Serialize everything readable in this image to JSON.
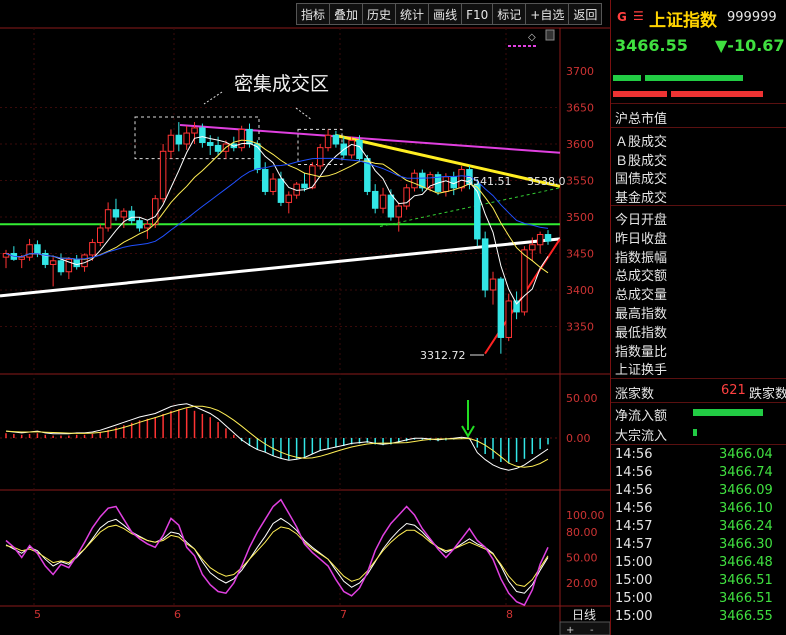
{
  "toolbar": [
    "指标",
    "叠加",
    "历史",
    "统计",
    "画线",
    "F10",
    "标记",
    "+自选",
    "返回"
  ],
  "annotations": {
    "cluster_label": "密集成交区",
    "level_high": "3541.51",
    "level_high2": "3538.0",
    "low_label": "3312.72",
    "kline_label": "日线"
  },
  "x_axis_ticks": [
    "5",
    "6",
    "7",
    "8"
  ],
  "price_axis": [
    "3700",
    "3650",
    "3600",
    "3550",
    "3500",
    "3450",
    "3400",
    "3350",
    "3300"
  ],
  "macd_axis": [
    "50.00",
    "0.00"
  ],
  "kdj_axis": [
    "100.00",
    "80.00",
    "50.00",
    "20.00"
  ],
  "quote": {
    "flag": "G",
    "menu_glyph": "☰",
    "name": "上证指数",
    "code": "999999",
    "price": "3466.55",
    "change": "▼-10.67"
  },
  "info_labels": [
    "沪总市值",
    "Ａ股成交",
    "Ｂ股成交",
    "国债成交",
    "基金成交",
    "今日开盘",
    "昨日收盘",
    "指数振幅",
    "总成交额",
    "总成交量",
    "最高指数",
    "最低指数",
    "指数量比",
    "上证换手"
  ],
  "breadth": {
    "up_label": "涨家数",
    "up_count": "621",
    "down_label": "跌家数"
  },
  "flows": {
    "net_inflow": "净流入额",
    "block_inflow": "大宗流入"
  },
  "ticks": [
    {
      "time": "14:56",
      "price": "3466.04"
    },
    {
      "time": "14:56",
      "price": "3466.74"
    },
    {
      "time": "14:56",
      "price": "3466.09"
    },
    {
      "time": "14:56",
      "price": "3466.10"
    },
    {
      "time": "14:57",
      "price": "3466.24"
    },
    {
      "time": "14:57",
      "price": "3466.30"
    },
    {
      "time": "15:00",
      "price": "3466.48"
    },
    {
      "time": "15:00",
      "price": "3466.51"
    },
    {
      "time": "15:00",
      "price": "3466.51"
    },
    {
      "time": "15:00",
      "price": "3466.55"
    }
  ],
  "colors": {
    "up": "#ff3333",
    "down": "#33e6e6",
    "accent_yellow": "#ffd400",
    "green_text": "#40e040"
  },
  "chart_data": [
    {
      "type": "candlestick",
      "ylim": [
        3300,
        3700
      ],
      "ohlc": [
        [
          3445,
          3455,
          3430,
          3450
        ],
        [
          3450,
          3460,
          3440,
          3442
        ],
        [
          3442,
          3448,
          3430,
          3445
        ],
        [
          3445,
          3470,
          3440,
          3462
        ],
        [
          3462,
          3468,
          3445,
          3450
        ],
        [
          3450,
          3455,
          3430,
          3435
        ],
        [
          3435,
          3445,
          3405,
          3440
        ],
        [
          3440,
          3450,
          3420,
          3425
        ],
        [
          3425,
          3445,
          3415,
          3442
        ],
        [
          3442,
          3448,
          3428,
          3432
        ],
        [
          3432,
          3450,
          3425,
          3448
        ],
        [
          3448,
          3470,
          3440,
          3465
        ],
        [
          3465,
          3490,
          3460,
          3485
        ],
        [
          3485,
          3520,
          3480,
          3510
        ],
        [
          3510,
          3525,
          3495,
          3500
        ],
        [
          3500,
          3512,
          3485,
          3508
        ],
        [
          3508,
          3515,
          3490,
          3495
        ],
        [
          3495,
          3500,
          3480,
          3485
        ],
        [
          3485,
          3495,
          3470,
          3490
        ],
        [
          3490,
          3530,
          3485,
          3525
        ],
        [
          3525,
          3600,
          3520,
          3590
        ],
        [
          3590,
          3620,
          3580,
          3612
        ],
        [
          3612,
          3630,
          3590,
          3600
        ],
        [
          3600,
          3625,
          3592,
          3615
        ],
        [
          3615,
          3630,
          3600,
          3622
        ],
        [
          3622,
          3628,
          3595,
          3602
        ],
        [
          3602,
          3612,
          3585,
          3598
        ],
        [
          3598,
          3610,
          3585,
          3590
        ],
        [
          3590,
          3605,
          3580,
          3600
        ],
        [
          3600,
          3610,
          3590,
          3595
        ],
        [
          3595,
          3625,
          3590,
          3620
        ],
        [
          3620,
          3628,
          3595,
          3600
        ],
        [
          3600,
          3605,
          3560,
          3565
        ],
        [
          3565,
          3575,
          3530,
          3535
        ],
        [
          3535,
          3560,
          3530,
          3552
        ],
        [
          3552,
          3562,
          3515,
          3520
        ],
        [
          3520,
          3535,
          3505,
          3530
        ],
        [
          3530,
          3548,
          3525,
          3545
        ],
        [
          3545,
          3560,
          3535,
          3540
        ],
        [
          3540,
          3575,
          3538,
          3570
        ],
        [
          3570,
          3600,
          3565,
          3595
        ],
        [
          3595,
          3620,
          3590,
          3612
        ],
        [
          3612,
          3618,
          3595,
          3600
        ],
        [
          3600,
          3610,
          3580,
          3585
        ],
        [
          3585,
          3610,
          3580,
          3605
        ],
        [
          3605,
          3612,
          3575,
          3580
        ],
        [
          3580,
          3585,
          3530,
          3535
        ],
        [
          3535,
          3545,
          3505,
          3512
        ],
        [
          3512,
          3540,
          3505,
          3530
        ],
        [
          3530,
          3538,
          3495,
          3500
        ],
        [
          3500,
          3520,
          3480,
          3515
        ],
        [
          3515,
          3545,
          3510,
          3540
        ],
        [
          3540,
          3565,
          3535,
          3560
        ],
        [
          3560,
          3565,
          3535,
          3540
        ],
        [
          3540,
          3562,
          3535,
          3558
        ],
        [
          3558,
          3562,
          3530,
          3535
        ],
        [
          3535,
          3560,
          3528,
          3555
        ],
        [
          3555,
          3562,
          3530,
          3540
        ],
        [
          3540,
          3570,
          3535,
          3565
        ],
        [
          3565,
          3570,
          3538,
          3545
        ],
        [
          3545,
          3552,
          3460,
          3470
        ],
        [
          3470,
          3480,
          3390,
          3400
        ],
        [
          3400,
          3425,
          3380,
          3415
        ],
        [
          3415,
          3418,
          3312.72,
          3335
        ],
        [
          3335,
          3395,
          3330,
          3385
        ],
        [
          3385,
          3398,
          3360,
          3370
        ],
        [
          3370,
          3460,
          3365,
          3455
        ],
        [
          3455,
          3472,
          3440,
          3462
        ],
        [
          3462,
          3480,
          3450,
          3476
        ],
        [
          3476,
          3482,
          3462,
          3467
        ]
      ]
    },
    {
      "type": "bar",
      "name": "MACD",
      "ylim": [
        -45,
        60
      ],
      "values": [
        6,
        5,
        4,
        5,
        6,
        4,
        3,
        3,
        3,
        4,
        4,
        5,
        7,
        10,
        13,
        16,
        19,
        22,
        24,
        26,
        30,
        34,
        36,
        37,
        34,
        30,
        26,
        20,
        12,
        4,
        -4,
        -10,
        -15,
        -18,
        -22,
        -25,
        -27,
        -26,
        -24,
        -20,
        -16,
        -14,
        -12,
        -10,
        -8,
        -7,
        -6,
        -8,
        -9,
        -8,
        -6,
        -4,
        -2,
        -2,
        -3,
        -4,
        -3,
        -2,
        -1,
        -2,
        -12,
        -20,
        -26,
        -30,
        -32,
        -30,
        -26,
        -20,
        -14,
        -8
      ]
    },
    {
      "type": "line",
      "name": "KDJ",
      "ylim": [
        0,
        120
      ],
      "series": [
        {
          "values": [
            65,
            60,
            55,
            62,
            58,
            48,
            40,
            45,
            42,
            50,
            60,
            72,
            85,
            92,
            95,
            88,
            80,
            75,
            70,
            68,
            72,
            80,
            78,
            68,
            60,
            45,
            32,
            25,
            20,
            25,
            35,
            48,
            62,
            75,
            90,
            96,
            90,
            82,
            70,
            62,
            55,
            48,
            35,
            22,
            15,
            20,
            30,
            45,
            60,
            72,
            82,
            90,
            88,
            80,
            70,
            62,
            56,
            60,
            66,
            72,
            66,
            62,
            55,
            40,
            22,
            10,
            8,
            18,
            35,
            50
          ]
        },
        {
          "values": [
            64,
            62,
            58,
            60,
            56,
            50,
            44,
            46,
            44,
            52,
            60,
            70,
            80,
            86,
            88,
            84,
            78,
            74,
            70,
            68,
            70,
            76,
            74,
            66,
            60,
            48,
            38,
            32,
            28,
            30,
            38,
            48,
            58,
            68,
            80,
            86,
            84,
            78,
            68,
            60,
            54,
            48,
            38,
            28,
            22,
            25,
            34,
            46,
            58,
            68,
            76,
            82,
            82,
            76,
            68,
            62,
            58,
            60,
            64,
            68,
            64,
            60,
            54,
            42,
            28,
            18,
            16,
            24,
            38,
            52
          ]
        },
        {
          "values": [
            70,
            62,
            50,
            64,
            55,
            40,
            30,
            42,
            38,
            52,
            68,
            85,
            98,
            108,
            110,
            95,
            80,
            72,
            66,
            62,
            76,
            96,
            88,
            62,
            52,
            30,
            18,
            10,
            8,
            20,
            40,
            62,
            80,
            95,
            110,
            118,
            102,
            86,
            66,
            56,
            48,
            40,
            24,
            10,
            5,
            14,
            32,
            58,
            76,
            90,
            100,
            110,
            100,
            84,
            72,
            60,
            50,
            60,
            72,
            84,
            70,
            62,
            48,
            25,
            8,
            -2,
            -6,
            12,
            42,
            62
          ]
        }
      ]
    }
  ]
}
